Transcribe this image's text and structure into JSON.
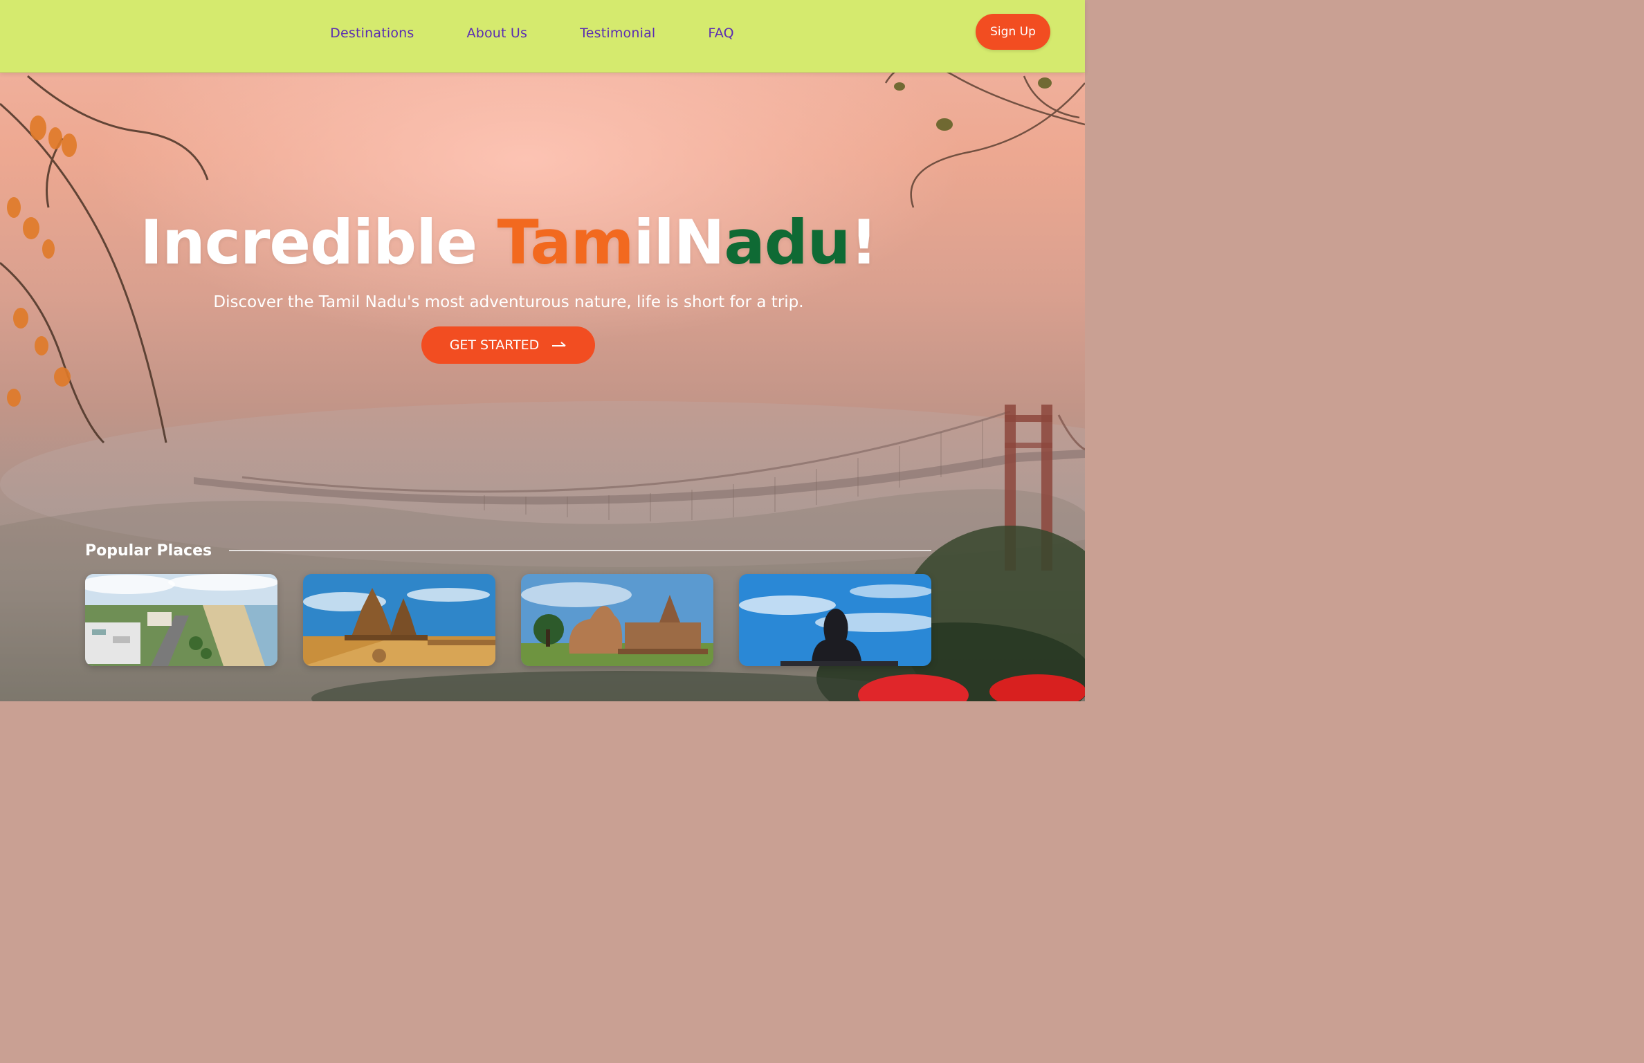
{
  "nav": {
    "links": [
      "Destinations",
      "About Us",
      "Testimonial",
      "FAQ"
    ],
    "signup_label": "Sign Up"
  },
  "hero": {
    "title_part1": "Incredible ",
    "title_part2": "Tam",
    "title_part3": "ilN",
    "title_part4": "adu",
    "title_part5": "!",
    "subtitle": "Discover the Tamil Nadu's most adventurous nature, life is short for a trip.",
    "cta_label": "GET STARTED",
    "cta_icon": "arrow-right-icon"
  },
  "popular": {
    "title": "Popular Places",
    "cards": [
      {
        "image": "city-beach-aerial"
      },
      {
        "image": "shore-temple"
      },
      {
        "image": "nandi-temple"
      },
      {
        "image": "adiyogi-statue"
      }
    ]
  },
  "colors": {
    "nav_bg": "#d5ea6e",
    "nav_link": "#5a2bb3",
    "accent": "#f24d21",
    "title_orange": "#f2691f",
    "title_green": "#0f6a34"
  }
}
